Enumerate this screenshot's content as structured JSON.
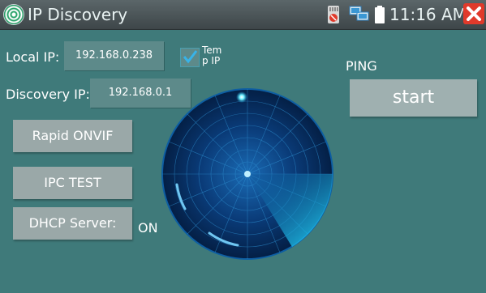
{
  "window": {
    "title": "IP Discovery",
    "clock": "11:16 AM",
    "icons": [
      "app-radar-icon",
      "sd-card-icon",
      "network-icon",
      "battery-icon",
      "close-icon"
    ]
  },
  "network": {
    "local_ip_label": "Local IP:",
    "local_ip_value": "192.168.0.238",
    "temp_ip_label": "Tem\np IP",
    "temp_ip_checked": true,
    "discovery_ip_label": "Discovery IP:",
    "discovery_ip_value": "192.168.0.1"
  },
  "buttons": {
    "rapid_onvif": "Rapid ONVIF",
    "ipc_test": "IPC TEST",
    "dhcp_server": "DHCP Server:",
    "dhcp_status": "ON"
  },
  "ping": {
    "label": "PING",
    "start": "start"
  },
  "colors": {
    "background": "#3f7a7a",
    "field": "#5d8a8a",
    "button": "#9aa8a8",
    "radar_dark": "#062c5a",
    "radar_sweep": "#1ec8ff",
    "close": "#e03a2b"
  }
}
